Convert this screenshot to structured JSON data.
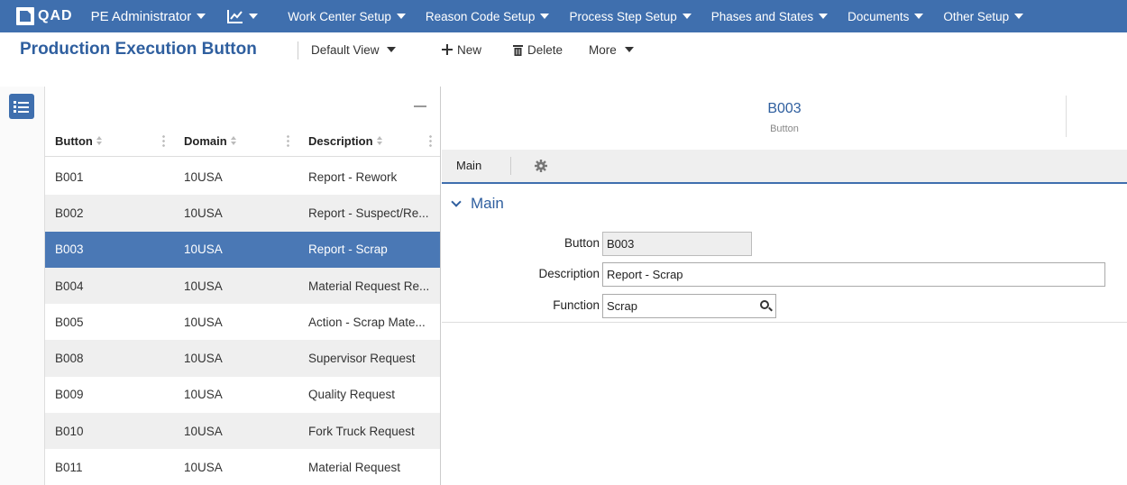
{
  "topnav": {
    "logo_text": "QAD",
    "role": "PE Administrator",
    "menus": [
      {
        "label": "Work Center Setup"
      },
      {
        "label": "Reason Code Setup"
      },
      {
        "label": "Process Step Setup"
      },
      {
        "label": "Phases and States"
      },
      {
        "label": "Documents"
      },
      {
        "label": "Other Setup"
      }
    ],
    "bg_color": "#3f6fae"
  },
  "header": {
    "title": "Production Execution Button",
    "view_label": "Default View",
    "new_label": "New",
    "delete_label": "Delete",
    "more_label": "More"
  },
  "list": {
    "columns": [
      "Button",
      "Domain",
      "Description"
    ],
    "rows": [
      {
        "button": "B001",
        "domain": "10USA",
        "description": "Report - Rework"
      },
      {
        "button": "B002",
        "domain": "10USA",
        "description": "Report - Suspect/Re..."
      },
      {
        "button": "B003",
        "domain": "10USA",
        "description": "Report - Scrap",
        "selected": true
      },
      {
        "button": "B004",
        "domain": "10USA",
        "description": "Material Request Re..."
      },
      {
        "button": "B005",
        "domain": "10USA",
        "description": "Action - Scrap Mate..."
      },
      {
        "button": "B008",
        "domain": "10USA",
        "description": "Supervisor Request"
      },
      {
        "button": "B009",
        "domain": "10USA",
        "description": "Quality Request"
      },
      {
        "button": "B010",
        "domain": "10USA",
        "description": "Fork Truck Request"
      },
      {
        "button": "B011",
        "domain": "10USA",
        "description": "Material Request"
      }
    ]
  },
  "detail": {
    "record_id": "B003",
    "record_type": "Button",
    "tab_main": "Main",
    "section_title": "Main",
    "fields": {
      "button_label": "Button",
      "button_value": "B003",
      "description_label": "Description",
      "description_value": "Report - Scrap",
      "function_label": "Function",
      "function_value": "Scrap"
    }
  }
}
